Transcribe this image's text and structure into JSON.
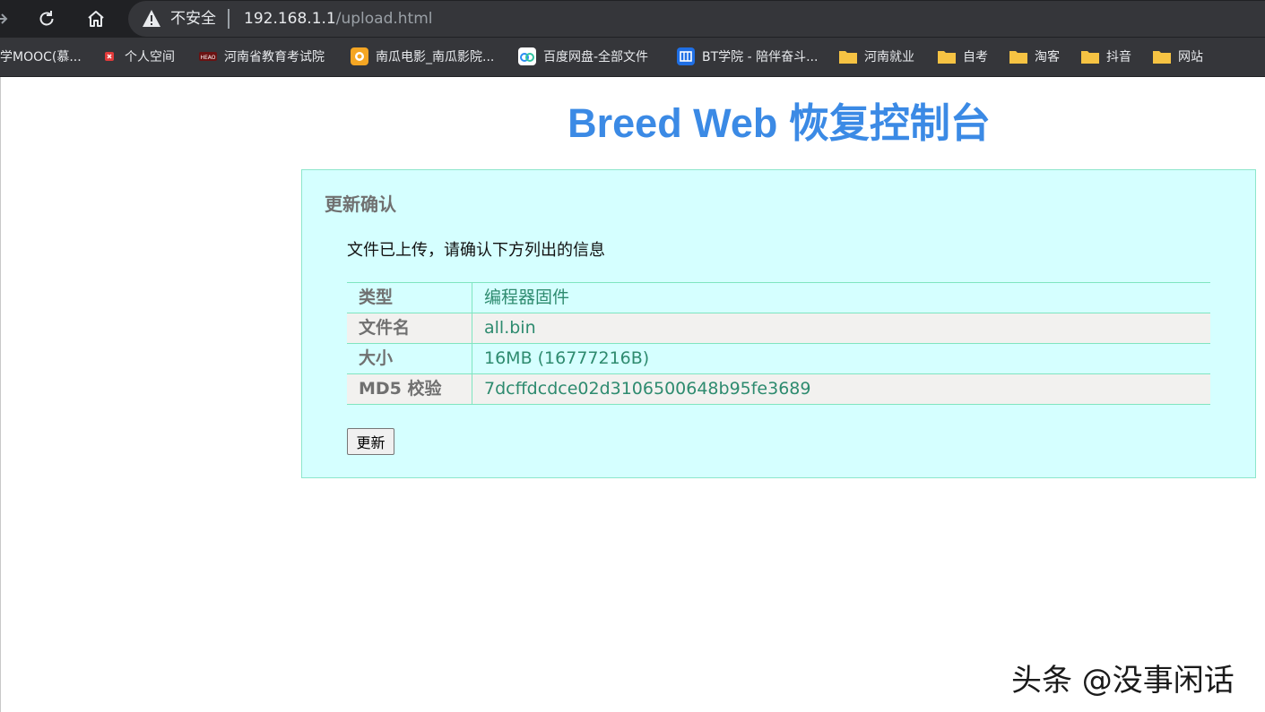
{
  "browser": {
    "security_label": "不安全",
    "url_host": "192.168.1.1",
    "url_path": "/upload.html",
    "bookmarks": [
      {
        "label": "学MOOC(慕...",
        "icon": "mooc-icon"
      },
      {
        "label": "个人空间",
        "icon": "personal-space-icon"
      },
      {
        "label": "河南省教育考试院",
        "icon": "exam-site-icon"
      },
      {
        "label": "南瓜电影_南瓜影院...",
        "icon": "pumpkin-movie-icon"
      },
      {
        "label": "百度网盘-全部文件",
        "icon": "baidu-pan-icon"
      },
      {
        "label": "BT学院 - 陪伴奋斗...",
        "icon": "bt-academy-icon"
      },
      {
        "label": "河南就业",
        "icon": "folder-icon"
      },
      {
        "label": "自考",
        "icon": "folder-icon"
      },
      {
        "label": "淘客",
        "icon": "folder-icon"
      },
      {
        "label": "抖音",
        "icon": "folder-icon"
      },
      {
        "label": "网站",
        "icon": "folder-icon"
      }
    ]
  },
  "page": {
    "title": "Breed Web 恢复控制台",
    "panel": {
      "heading": "更新确认",
      "description": "文件已上传，请确认下方列出的信息",
      "rows": [
        {
          "key": "类型",
          "value": "编程器固件"
        },
        {
          "key": "文件名",
          "value": "all.bin"
        },
        {
          "key": "大小",
          "value": "16MB (16777216B)"
        },
        {
          "key": "MD5 校验",
          "value": "7dcffdcdce02d3106500648b95fe3689"
        }
      ],
      "button_label": "更新"
    }
  },
  "watermark": "头条 @没事闲话",
  "colors": {
    "title": "#3b8ae5",
    "panel_bg": "#d5ffff",
    "panel_border": "#8ce6cc",
    "value_text": "#2e8b6f",
    "browser_dark": "#202124"
  }
}
